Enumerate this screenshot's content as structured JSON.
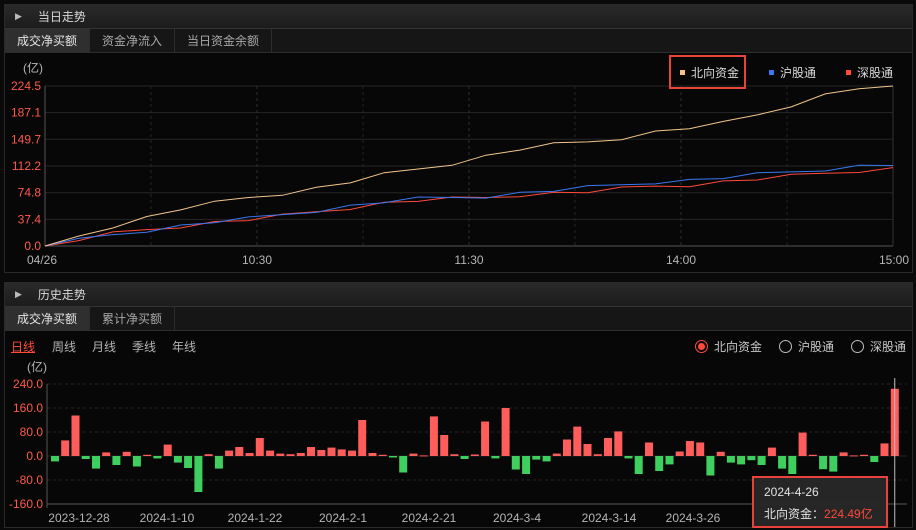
{
  "top_panel": {
    "title": "当日走势",
    "tabs": [
      "成交净买额",
      "资金净流入",
      "当日资金余额"
    ],
    "legend": [
      {
        "label": "北向资金",
        "color": "#f2c48a"
      },
      {
        "label": "沪股通",
        "color": "#3a78f0"
      },
      {
        "label": "深股通",
        "color": "#ff4a3a"
      }
    ]
  },
  "bottom_panel": {
    "title": "历史走势",
    "tabs": [
      "成交净买额",
      "累计净买额"
    ],
    "periods": [
      "日线",
      "周线",
      "月线",
      "季线",
      "年线"
    ],
    "radios": [
      "北向资金",
      "沪股通",
      "深股通"
    ],
    "tooltip": {
      "date": "2024-4-26",
      "label": "北向资金：",
      "value": "224.49亿"
    }
  },
  "chart_data": [
    {
      "type": "line",
      "unit": "(亿)",
      "x_ticks": [
        "04/26",
        "10:30",
        "11:30",
        "14:00",
        "15:00"
      ],
      "y_ticks": [
        "224.5",
        "187.1",
        "149.7",
        "112.2",
        "74.8",
        "37.4",
        "0.0"
      ],
      "ylim": [
        0,
        224.5
      ],
      "grid": true,
      "series": [
        {
          "name": "北向资金",
          "color": "#f2c48a",
          "values": [
            0,
            14,
            28,
            40,
            52,
            60,
            68,
            74,
            81,
            90,
            100,
            108,
            116,
            126,
            136,
            142,
            146,
            152,
            160,
            166,
            172,
            184,
            198,
            212,
            222,
            224.5
          ]
        },
        {
          "name": "沪股通",
          "color": "#3a78f0",
          "values": [
            0,
            8,
            16,
            22,
            28,
            34,
            38,
            44,
            50,
            56,
            62,
            66,
            68,
            70,
            74,
            78,
            82,
            86,
            90,
            92,
            96,
            100,
            104,
            108,
            112,
            113
          ]
        },
        {
          "name": "深股通",
          "color": "#ff4a3a",
          "values": [
            0,
            9,
            17,
            23,
            28,
            33,
            37,
            42,
            48,
            54,
            60,
            64,
            66,
            68,
            72,
            74,
            76,
            80,
            84,
            86,
            90,
            94,
            98,
            102,
            106,
            110
          ]
        }
      ]
    },
    {
      "type": "bar",
      "unit": "(亿)",
      "x_ticks": [
        "2023-12-28",
        "2024-1-10",
        "2024-1-22",
        "2024-2-1",
        "2024-2-21",
        "2024-3-4",
        "2024-3-14",
        "2024-3-26",
        "2024-4-26"
      ],
      "y_ticks": [
        "240.0",
        "160.0",
        "80.0",
        "0.0",
        "-80.0",
        "-160.0"
      ],
      "ylim": [
        -160,
        240
      ],
      "grid": true,
      "series": [
        {
          "name": "北向资金",
          "values": [
            -18,
            52,
            135,
            -10,
            -42,
            12,
            -30,
            14,
            -35,
            4,
            -8,
            38,
            -22,
            -40,
            -120,
            6,
            -42,
            18,
            30,
            10,
            60,
            18,
            8,
            6,
            10,
            30,
            20,
            28,
            22,
            18,
            120,
            10,
            4,
            -5,
            -55,
            8,
            2,
            132,
            70,
            6,
            -10,
            5,
            115,
            -8,
            160,
            -45,
            -60,
            -12,
            -18,
            8,
            55,
            98,
            40,
            6,
            60,
            82,
            -8,
            -60,
            45,
            -50,
            -28,
            15,
            50,
            45,
            -65,
            14,
            -22,
            -28,
            -14,
            -30,
            28,
            -42,
            -60,
            78,
            4,
            -44,
            -52,
            12,
            2,
            4,
            -20,
            42,
            224
          ]
        }
      ]
    }
  ]
}
